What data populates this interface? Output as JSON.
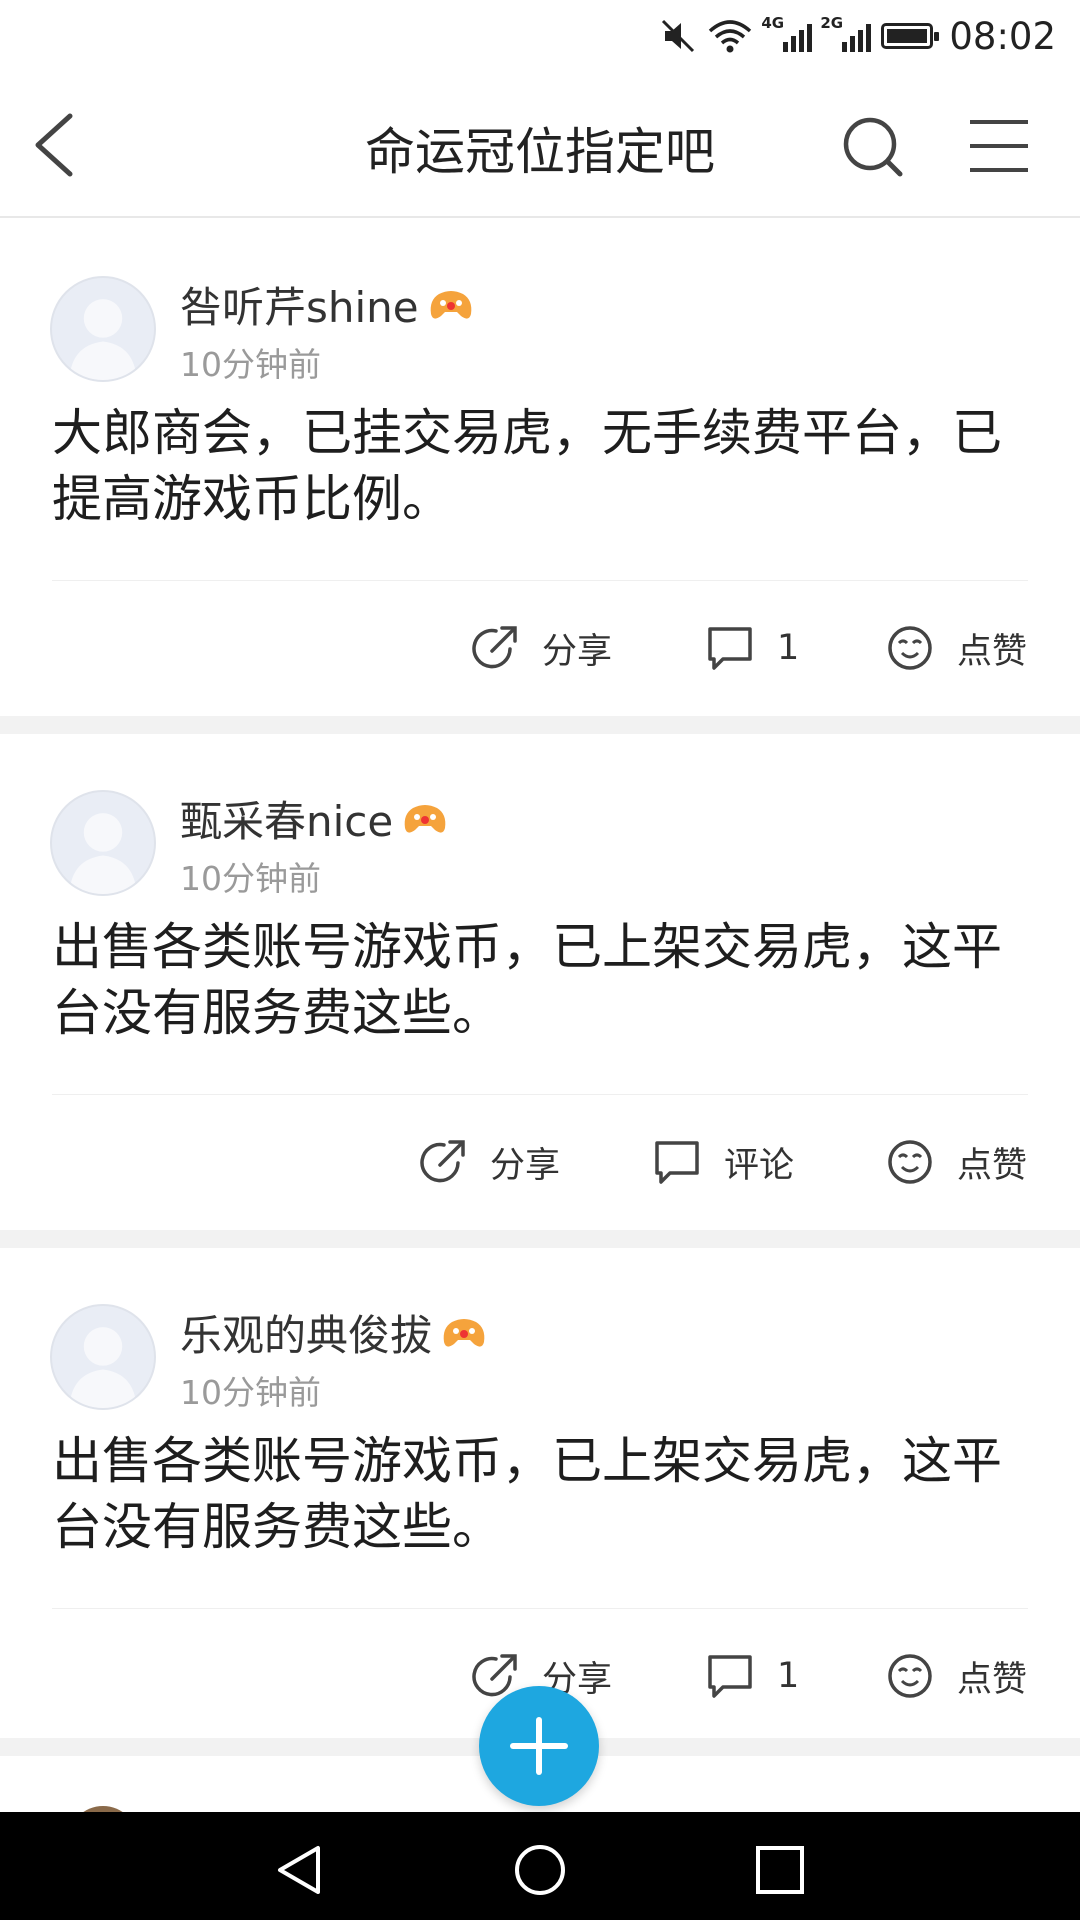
{
  "status_bar": {
    "time": "08:02",
    "network_1": "4G",
    "network_2": "2G",
    "icons": [
      "mute-icon",
      "wifi-icon",
      "signal-4g-icon",
      "signal-2g-icon",
      "battery-icon"
    ]
  },
  "header": {
    "title": "命运冠位指定吧",
    "icons": [
      "back-icon",
      "search-icon",
      "menu-icon"
    ]
  },
  "posts": [
    {
      "username": "咎听芹shine",
      "time": "10分钟前",
      "content": "大郎商会，已挂交易虎，无手续费平台，已提高游戏币比例。",
      "share_label": "分享",
      "comment_label": "1",
      "like_label": "点赞"
    },
    {
      "username": "甄采春nice",
      "time": "10分钟前",
      "content": "出售各类账号游戏币，已上架交易虎，这平台没有服务费这些。",
      "share_label": "分享",
      "comment_label": "评论",
      "like_label": "点赞"
    },
    {
      "username": "乐观的典俊拔",
      "time": "10分钟前",
      "content": "出售各类账号游戏币，已上架交易虎，这平台没有服务费这些。",
      "share_label": "分享",
      "comment_label": "1",
      "like_label": "点赞"
    }
  ],
  "colors": {
    "accent": "#1ea7e0",
    "badge": "#f5a33c",
    "text_primary": "#1e1e1e",
    "text_secondary": "#9a9a9a",
    "separator": "#f2f2f2"
  }
}
